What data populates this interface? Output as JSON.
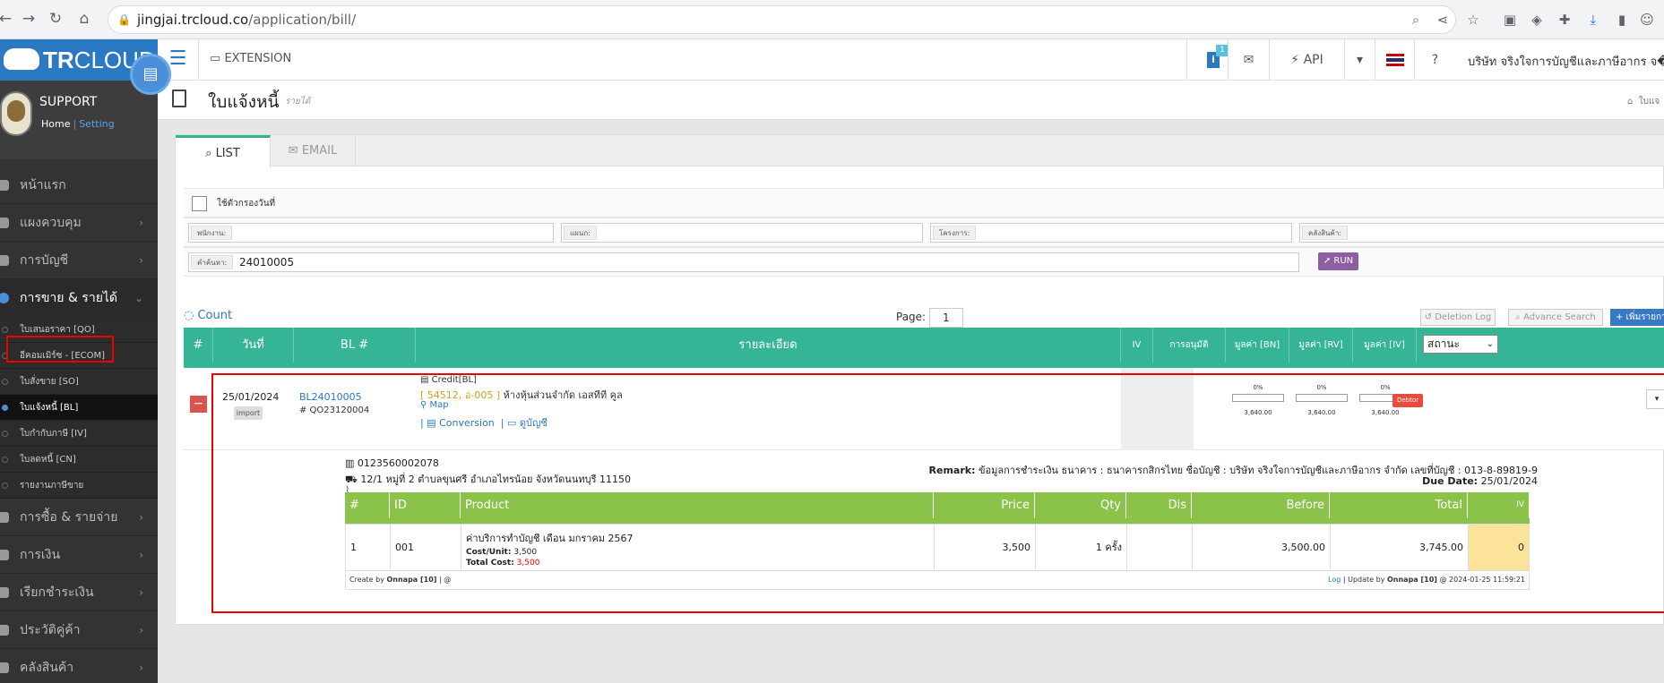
{
  "browser": {
    "url_host": "jingjai.trcloud.co",
    "url_path": "/application/bill/"
  },
  "app": {
    "logo_bold": "TR",
    "logo_light": "CLOUD",
    "brand_color": "#2b79c2"
  },
  "profile": {
    "name": "SUPPORT",
    "home": "Home",
    "setting": "Setting"
  },
  "sidebar": {
    "items": [
      {
        "label": "หน้าแรก"
      },
      {
        "label": "แผงควบคุม"
      },
      {
        "label": "การบัญชี"
      },
      {
        "label": "การขาย & รายได้"
      },
      {
        "label": "การซื้อ & รายจ่าย"
      },
      {
        "label": "การเงิน"
      },
      {
        "label": "เรียกชำระเงิน"
      },
      {
        "label": "ประวัติคู่ค้า"
      },
      {
        "label": "คลังสินค้า"
      }
    ],
    "subitems": [
      {
        "label": "ใบเสนอราคา [QO]"
      },
      {
        "label": "อีคอมเมิร์ซ - [ECOM]"
      },
      {
        "label": "ใบสั่งขาย [SO]"
      },
      {
        "label": "ใบแจ้งหนี้ [BL]"
      },
      {
        "label": "ใบกำกับภาษี [IV]"
      },
      {
        "label": "ใบลดหนี้ [CN]"
      },
      {
        "label": "รายงานภาษีขาย"
      }
    ]
  },
  "topbar": {
    "extension": "EXTENSION",
    "info_count": "1",
    "api": "API",
    "company": "บริษัท จริงใจการบัญชีและภาษีอากร จ�"
  },
  "page": {
    "title": "ใบแจ้งหนี้",
    "subtitle": "รายได้",
    "breadcrumb": "ใบแจ"
  },
  "tabs": [
    {
      "label": "LIST"
    },
    {
      "label": "EMAIL"
    }
  ],
  "filters": {
    "date_filter_label": "ใช้ตัวกรองวันที่",
    "employee_label": "พนักงาน:",
    "department_label": "แผนก:",
    "project_label": "โครงการ:",
    "warehouse_label": "คลังสินค้า:",
    "search_label": "คำค้นหา:",
    "search_value": "24010005",
    "run": "RUN"
  },
  "list": {
    "count": "Count",
    "page_label": "Page:",
    "page_value": "1",
    "deletion_log": "Deletion Log",
    "advance_search": "Advance Search",
    "add_new": "+ เพิ่มรายการ",
    "columns": [
      "#",
      "วันที่",
      "BL #",
      "รายละเอียด",
      "IV",
      "การอนุมัติ",
      "มูลค่า [BN]",
      "มูลค่า [RV]",
      "มูลค่า [IV]"
    ],
    "status_select": "สถานะ"
  },
  "record": {
    "date": "25/01/2024",
    "import": "import",
    "bl_no": "BL24010005",
    "qo_no": "# QO23120004",
    "credit": "Credit[BL]",
    "code": "[ 54512, อ-005 ]",
    "customer": "ห้างหุ้นส่วนจำกัด เอสทีที คูล",
    "map": "Map",
    "conversion": "Conversion",
    "view_account": "ดูบัญชี",
    "progress": [
      {
        "pct": "0%",
        "value": "3,640.00"
      },
      {
        "pct": "0%",
        "value": "3,640.00"
      },
      {
        "pct": "0%",
        "value": "3,640.00"
      }
    ],
    "status": "Debtor"
  },
  "detail": {
    "tax_id": "0123560002078",
    "address": "12/1 หมู่ที่ 2 ตำบลขุนศรี อำเภอไทรน้อย จังหวัดนนทบุรี 11150",
    "remark_label": "Remark:",
    "remark": "ข้อมูลการชำระเงิน ธนาคาร : ธนาคารกสิกรไทย ชื่อบัญชี : บริษัท จริงใจการบัญชีและภาษีอากร จำกัด เลขที่บัญชี : 013-8-89819-9",
    "due_label": "Due Date:",
    "due": "25/01/2024",
    "item_columns": [
      "#",
      "ID",
      "Product",
      "Price",
      "Qty",
      "Dis",
      "Before",
      "Total",
      "IV"
    ],
    "item": {
      "no": "1",
      "id": "001",
      "product": "ค่าบริการทำบัญชี เดือน มกราคม 2567",
      "cost_unit_label": "Cost/Unit:",
      "cost_unit": "3,500",
      "total_cost_label": "Total Cost:",
      "total_cost": "3,500",
      "price": "3,500",
      "qty": "1 ครั้ง",
      "dis": "",
      "before": "3,500.00",
      "total": "3,745.00",
      "iv": "0"
    },
    "create_prefix": "Create by",
    "create_user": "Onnapa [10]",
    "create_suffix": "| @",
    "log": "Log",
    "update_prefix": "| Update by",
    "update_user": "Onnapa [10]",
    "update_time": "@ 2024-01-25 11:59:21"
  },
  "colors": {
    "table_header": "#35b496",
    "item_header": "#8bc34a",
    "debtor": "#e74c3c",
    "highlight": "#e00000"
  }
}
